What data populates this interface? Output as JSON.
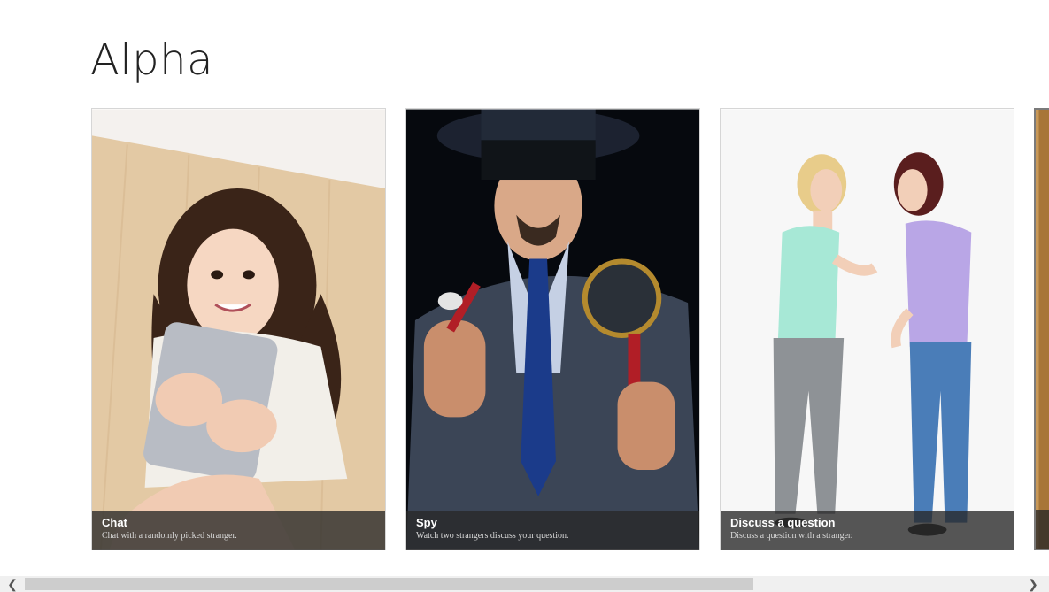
{
  "page": {
    "title": "Alpha"
  },
  "tiles": [
    {
      "title": "Chat",
      "subtitle": "Chat with a randomly picked stranger."
    },
    {
      "title": "Spy",
      "subtitle": "Watch two strangers discuss your question."
    },
    {
      "title": "Discuss a question",
      "subtitle": "Discuss a question with a stranger."
    },
    {
      "title": "",
      "subtitle": ""
    }
  ],
  "scrollbar": {
    "left_icon": "chevron-left-icon",
    "right_icon": "chevron-right-icon",
    "position_fraction": 0.0
  },
  "colors": {
    "caption_bg": "#282828",
    "accent": "#ffffff"
  }
}
